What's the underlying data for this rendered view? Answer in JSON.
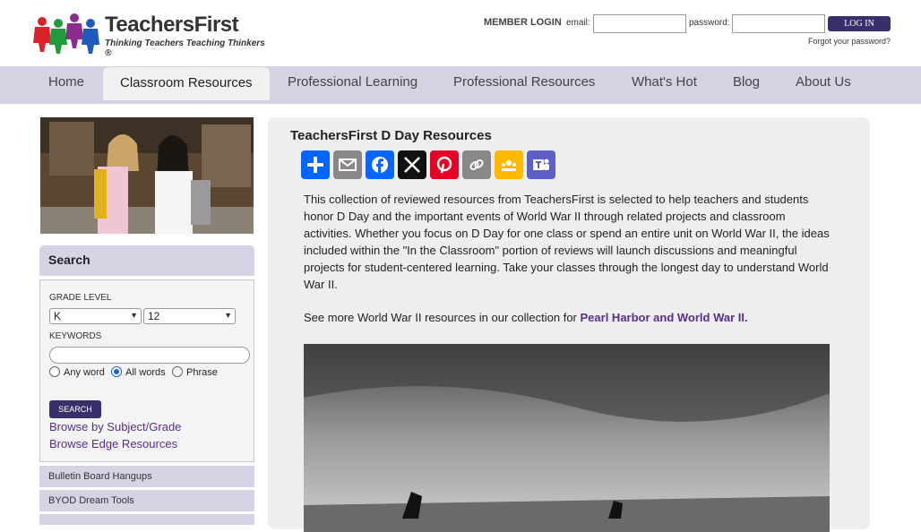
{
  "brand": {
    "name": "TeachersFirst",
    "tagline": "Thinking Teachers Teaching Thinkers ®"
  },
  "login": {
    "heading": "MEMBER LOGIN",
    "email_label": "email:",
    "password_label": "password:",
    "button": "LOG IN",
    "forgot": "Forgot your password?"
  },
  "nav": {
    "items": [
      {
        "label": "Home"
      },
      {
        "label": "Classroom Resources"
      },
      {
        "label": "Professional Learning"
      },
      {
        "label": "Professional Resources"
      },
      {
        "label": "What's Hot"
      },
      {
        "label": "Blog"
      },
      {
        "label": "About Us"
      }
    ],
    "active": "Classroom Resources"
  },
  "search": {
    "heading": "Search",
    "grade_level_label": "GRADE LEVEL",
    "grade_from": "K",
    "grade_to": "12",
    "keywords_label": "KEYWORDS",
    "keywords_value": "",
    "match_options": [
      "Any word",
      "All words",
      "Phrase"
    ],
    "match_selected": "All words",
    "button": "SEARCH",
    "links": [
      "Browse by Subject/Grade",
      "Browse Edge Resources"
    ]
  },
  "sidebar_items": [
    "Bulletin Board Hangups",
    "BYOD Dream Tools"
  ],
  "content": {
    "title": "TeachersFirst D Day Resources",
    "share_buttons": [
      {
        "icon": "share-plus-icon",
        "color": "#0166ff"
      },
      {
        "icon": "email-icon",
        "color": "#888888"
      },
      {
        "icon": "facebook-icon",
        "color": "#0866ff"
      },
      {
        "icon": "x-icon",
        "color": "#111111"
      },
      {
        "icon": "pinterest-icon",
        "color": "#e60023"
      },
      {
        "icon": "copy-link-icon",
        "color": "#888888"
      },
      {
        "icon": "google-classroom-icon",
        "color": "#ffba00"
      },
      {
        "icon": "teams-icon",
        "color": "#5b5fc7"
      }
    ],
    "intro": "This collection of reviewed resources from TeachersFirst is selected to help teachers and students honor D Day and the important events of World War II through related projects and classroom activities. Whether you focus on D Day for one class or spend an entire unit on World War II, the ideas included within the \"In the Classroom\" portion of reviews will launch discussions and meaningful projects for student-centered learning. Take your classes through the longest day to understand World War II.",
    "see_more_prefix": "See more World War II resources in our collection for ",
    "see_more_link": "Pearl Harbor and World War II."
  }
}
